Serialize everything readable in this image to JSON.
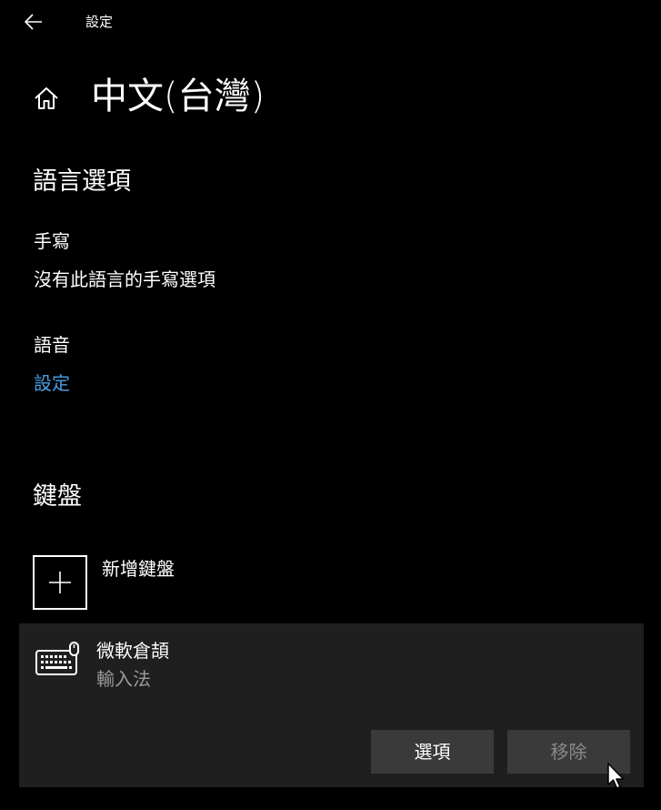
{
  "window": {
    "title": "設定"
  },
  "header": {
    "page_title": "中文(台灣)"
  },
  "language_options": {
    "heading": "語言選項",
    "handwriting": {
      "label": "手寫",
      "value": "沒有此語言的手寫選項"
    },
    "speech": {
      "label": "語音",
      "link": "設定"
    }
  },
  "keyboards": {
    "heading": "鍵盤",
    "add_label": "新增鍵盤",
    "items": [
      {
        "name": "微軟倉頡",
        "subtitle": "輸入法",
        "options_button": "選項",
        "remove_button": "移除"
      }
    ]
  },
  "colors": {
    "background": "#000000",
    "link": "#4a9fe6",
    "panel": "#1f1f1f",
    "button": "#3a3a3a"
  }
}
